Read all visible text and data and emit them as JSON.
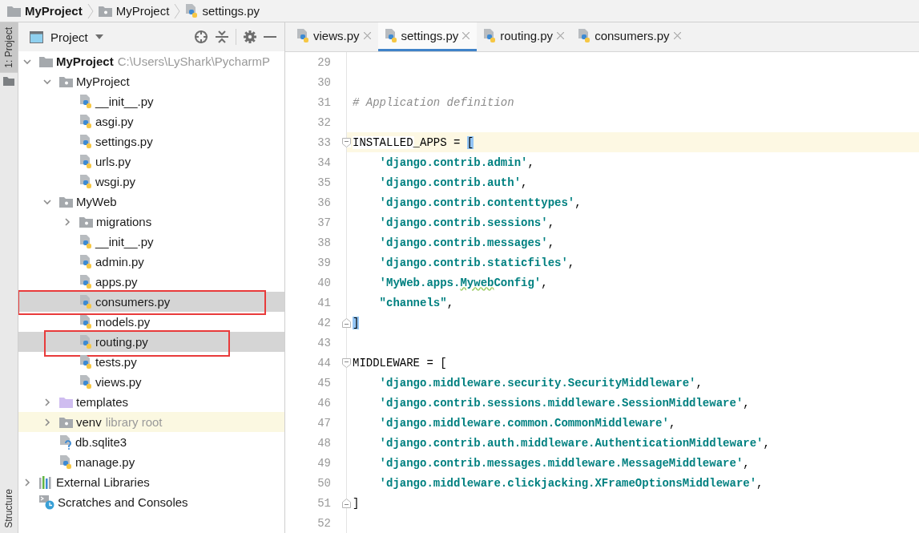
{
  "breadcrumb": [
    {
      "kind": "folder",
      "label": "MyProject",
      "bold": true
    },
    {
      "kind": "source-folder",
      "label": "MyProject",
      "bold": false
    },
    {
      "kind": "python",
      "label": "settings.py",
      "bold": false
    }
  ],
  "side_strip": {
    "top": {
      "label": "1: Project",
      "selected": true
    },
    "bottom": {
      "label": "Structure",
      "selected": false
    }
  },
  "project_panel": {
    "title": "Project",
    "tree": [
      {
        "kind": "folder",
        "name": "MyProject",
        "bold": true,
        "hint": "C:\\Users\\LyShark\\PycharmP",
        "expanded": true,
        "selected": false,
        "marked": false,
        "children": [
          {
            "kind": "source-folder",
            "name": "MyProject",
            "expanded": true,
            "selected": false,
            "marked": false,
            "children": [
              {
                "kind": "python",
                "name": "__init__.py",
                "selected": false,
                "marked": false
              },
              {
                "kind": "python",
                "name": "asgi.py",
                "selected": false,
                "marked": false
              },
              {
                "kind": "python",
                "name": "settings.py",
                "selected": false,
                "marked": false
              },
              {
                "kind": "python",
                "name": "urls.py",
                "selected": false,
                "marked": false
              },
              {
                "kind": "python",
                "name": "wsgi.py",
                "selected": false,
                "marked": false
              }
            ]
          },
          {
            "kind": "source-folder",
            "name": "MyWeb",
            "expanded": true,
            "selected": false,
            "marked": false,
            "children": [
              {
                "kind": "source-folder",
                "name": "migrations",
                "expanded": false,
                "selected": false,
                "marked": false
              },
              {
                "kind": "python",
                "name": "__init__.py",
                "selected": false,
                "marked": false
              },
              {
                "kind": "python",
                "name": "admin.py",
                "selected": false,
                "marked": false
              },
              {
                "kind": "python",
                "name": "apps.py",
                "selected": false,
                "marked": false
              },
              {
                "kind": "python",
                "name": "consumers.py",
                "selected": true,
                "marked": true
              },
              {
                "kind": "python",
                "name": "models.py",
                "selected": false,
                "marked": false
              },
              {
                "kind": "python",
                "name": "routing.py",
                "selected": true,
                "marked": true
              },
              {
                "kind": "python",
                "name": "tests.py",
                "selected": false,
                "marked": false
              },
              {
                "kind": "python",
                "name": "views.py",
                "selected": false,
                "marked": false
              }
            ]
          },
          {
            "kind": "template-folder",
            "name": "templates",
            "expanded": false,
            "selected": false,
            "marked": false
          },
          {
            "kind": "source-folder",
            "name": "venv",
            "hint": "library root",
            "tinted": true,
            "expanded": false,
            "selected": false,
            "marked": false
          },
          {
            "kind": "unknown-file",
            "name": "db.sqlite3",
            "selected": false,
            "marked": false
          },
          {
            "kind": "python",
            "name": "manage.py",
            "selected": false,
            "marked": false
          }
        ]
      },
      {
        "kind": "libraries",
        "name": "External Libraries",
        "expanded": false,
        "selected": false,
        "marked": false
      },
      {
        "kind": "scratches",
        "name": "Scratches and Consoles",
        "selected": false,
        "marked": false
      }
    ]
  },
  "tabs": [
    {
      "label": "views.py",
      "selected": false
    },
    {
      "label": "settings.py",
      "selected": true
    },
    {
      "label": "routing.py",
      "selected": false
    },
    {
      "label": "consumers.py",
      "selected": false
    }
  ],
  "code_lines": [
    {
      "number": "29"
    },
    {
      "number": "30"
    },
    {
      "number": "31",
      "tokens": [
        {
          "kind": "comment",
          "text": "# Application definition"
        }
      ]
    },
    {
      "number": "32"
    },
    {
      "number": "33",
      "current": true,
      "fold_start": true,
      "tokens": [
        {
          "kind": "plain",
          "text": "INSTALLED_APPS = "
        },
        {
          "kind": "brace-match",
          "text": "["
        }
      ]
    },
    {
      "number": "34",
      "tokens": [
        {
          "kind": "string",
          "text": "    'django.contrib.admin'"
        },
        {
          "kind": "plain",
          "text": ","
        }
      ]
    },
    {
      "number": "35",
      "tokens": [
        {
          "kind": "string",
          "text": "    'django.contrib.auth'"
        },
        {
          "kind": "plain",
          "text": ","
        }
      ]
    },
    {
      "number": "36",
      "tokens": [
        {
          "kind": "string",
          "text": "    'django.contrib.contenttypes'"
        },
        {
          "kind": "plain",
          "text": ","
        }
      ]
    },
    {
      "number": "37",
      "tokens": [
        {
          "kind": "string",
          "text": "    'django.contrib.sessions'"
        },
        {
          "kind": "plain",
          "text": ","
        }
      ]
    },
    {
      "number": "38",
      "tokens": [
        {
          "kind": "string",
          "text": "    'django.contrib.messages'"
        },
        {
          "kind": "plain",
          "text": ","
        }
      ]
    },
    {
      "number": "39",
      "tokens": [
        {
          "kind": "string",
          "text": "    'django.contrib.staticfiles'"
        },
        {
          "kind": "plain",
          "text": ","
        }
      ]
    },
    {
      "number": "40",
      "tokens": [
        {
          "kind": "string",
          "text": "    'MyWeb.apps."
        },
        {
          "kind": "typo",
          "text": "Myweb"
        },
        {
          "kind": "string",
          "text": "Config'"
        },
        {
          "kind": "plain",
          "text": ","
        }
      ]
    },
    {
      "number": "41",
      "tokens": [
        {
          "kind": "string",
          "text": "    \"channels\""
        },
        {
          "kind": "plain",
          "text": ","
        }
      ]
    },
    {
      "number": "42",
      "fold_end": true,
      "tokens": [
        {
          "kind": "brace-match",
          "text": "]"
        }
      ]
    },
    {
      "number": "43"
    },
    {
      "number": "44",
      "fold_start": true,
      "tokens": [
        {
          "kind": "plain",
          "text": "MIDDLEWARE = ["
        }
      ]
    },
    {
      "number": "45",
      "tokens": [
        {
          "kind": "string",
          "text": "    'django.middleware.security.SecurityMiddleware'"
        },
        {
          "kind": "plain",
          "text": ","
        }
      ]
    },
    {
      "number": "46",
      "tokens": [
        {
          "kind": "string",
          "text": "    'django.contrib.sessions.middleware.SessionMiddleware'"
        },
        {
          "kind": "plain",
          "text": ","
        }
      ]
    },
    {
      "number": "47",
      "tokens": [
        {
          "kind": "string",
          "text": "    'django.middleware.common.CommonMiddleware'"
        },
        {
          "kind": "plain",
          "text": ","
        }
      ]
    },
    {
      "number": "48",
      "tokens": [
        {
          "kind": "string",
          "text": "    'django.contrib.auth.middleware.AuthenticationMiddleware'"
        },
        {
          "kind": "plain",
          "text": ","
        }
      ]
    },
    {
      "number": "49",
      "tokens": [
        {
          "kind": "string",
          "text": "    'django.contrib.messages.middleware.MessageMiddleware'"
        },
        {
          "kind": "plain",
          "text": ","
        }
      ]
    },
    {
      "number": "50",
      "tokens": [
        {
          "kind": "string",
          "text": "    'django.middleware.clickjacking.XFrameOptionsMiddleware'"
        },
        {
          "kind": "plain",
          "text": ","
        }
      ]
    },
    {
      "number": "51",
      "fold_end": true,
      "tokens": [
        {
          "kind": "plain",
          "text": "]"
        }
      ]
    },
    {
      "number": "52"
    }
  ]
}
